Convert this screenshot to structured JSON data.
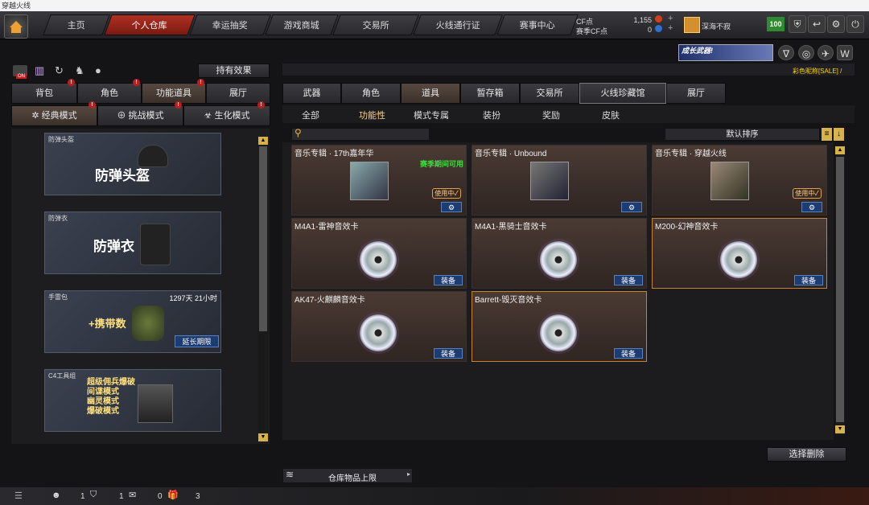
{
  "window": {
    "title": "穿越火线"
  },
  "nav": {
    "tabs": [
      "主页",
      "个人仓库",
      "幸运抽奖",
      "游戏商城",
      "交易所",
      "火线通行证",
      "赛事中心"
    ],
    "active": 1
  },
  "currency": {
    "cf_label": "CF点",
    "cf_value": "1,155",
    "season_label": "赛季CF点",
    "season_value": "0"
  },
  "user": {
    "name": "深海不寂",
    "level": "100"
  },
  "banner": {
    "promo": "成长武器!",
    "nickname_hint": "彩色昵称[SALE] /"
  },
  "left": {
    "effects_button": "持有效果",
    "subtabs": [
      "背包",
      "角色",
      "功能道具",
      "展厅"
    ],
    "modes": [
      "经典模式",
      "挑战模式",
      "生化模式"
    ],
    "cards": [
      {
        "name": "防弹头盔",
        "title": "防弹头盔"
      },
      {
        "name": "防弹衣",
        "title": "防弹衣"
      },
      {
        "name": "手雷包",
        "title": "+携带数",
        "duration": "1297天 21小时",
        "button": "延长期限"
      },
      {
        "name": "C4工具组",
        "lines": [
          "超级佣兵爆破",
          "间谍模式",
          "幽灵模式",
          "爆破模式"
        ]
      }
    ],
    "badge_mark": "!",
    "on_label": "ON"
  },
  "right": {
    "tabs": [
      "武器",
      "角色",
      "道具",
      "暂存箱",
      "交易所",
      "火线珍藏馆",
      "展厅"
    ],
    "active_tab": 2,
    "subtabs": [
      "全部",
      "功能性",
      "模式专属",
      "装扮",
      "奖励",
      "皮肤"
    ],
    "active_subtab": 1,
    "sort_label": "默认排序",
    "items": [
      {
        "name": "音乐专辑 · 17th嘉年华",
        "note": "赛季期间可用",
        "status": "使用中✓",
        "action": "⚙",
        "kind": "album"
      },
      {
        "name": "音乐专辑 · Unbound",
        "action": "⚙",
        "kind": "album"
      },
      {
        "name": "音乐专辑 · 穿越火线",
        "status": "使用中✓",
        "action": "⚙",
        "kind": "album"
      },
      {
        "name": "M4A1-雷神音效卡",
        "action": "装备",
        "kind": "disc"
      },
      {
        "name": "M4A1-黑骑士音效卡",
        "action": "装备",
        "kind": "disc"
      },
      {
        "name": "M200-幻神音效卡",
        "action": "装备",
        "kind": "disc"
      },
      {
        "name": "AK47-火麒麟音效卡",
        "action": "装备",
        "kind": "disc"
      },
      {
        "name": "Barrett-毁灭音效卡",
        "action": "装备",
        "kind": "disc"
      }
    ],
    "delete_button": "选择删除",
    "capacity_label": "仓库物品上限"
  },
  "bottom": {
    "counts": [
      "1",
      "1",
      "0",
      "3"
    ]
  }
}
